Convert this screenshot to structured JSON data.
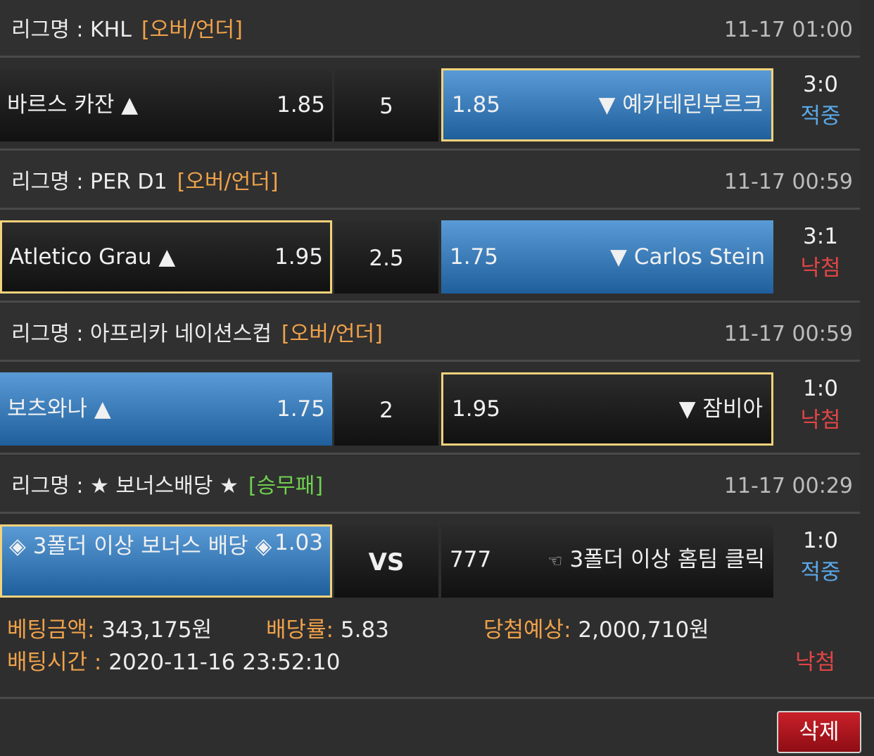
{
  "league_prefix": "리그명 : ",
  "matches": [
    {
      "league": "KHL",
      "bet_type": "[오버/언더]",
      "time": "11-17 01:00",
      "home": "바르스 카잔 ▲",
      "home_odds": "1.85",
      "line": "5",
      "away_odds": "1.85",
      "away": "▼ 예카테린부르크",
      "score": "3:0",
      "status": "적중"
    },
    {
      "league": "PER D1",
      "bet_type": "[오버/언더]",
      "time": "11-17 00:59",
      "home": "Atletico Grau ▲",
      "home_odds": "1.95",
      "line": "2.5",
      "away_odds": "1.75",
      "away": "▼ Carlos Stein",
      "score": "3:1",
      "status": "낙첨"
    },
    {
      "league": "아프리카 네이션스컵",
      "bet_type": "[오버/언더]",
      "time": "11-17 00:59",
      "home": "보츠와나 ▲",
      "home_odds": "1.75",
      "line": "2",
      "away_odds": "1.95",
      "away": "▼ 잠비아",
      "score": "1:0",
      "status": "낙첨"
    },
    {
      "league": "★ 보너스배당 ★",
      "bet_type": "[승무패]",
      "time": "11-17 00:29",
      "home": "◈ 3폴더 이상 보너스 배당 ◈",
      "home_odds": "1.03",
      "line": "VS",
      "away_odds": "777",
      "away_icon": "☜",
      "away": "3폴더 이상 홈팀 클릭",
      "score": "1:0",
      "status": "적중"
    }
  ],
  "summary": {
    "amount_label": "베팅금액:",
    "amount": "343,175원",
    "rate_label": "배당률:",
    "rate": "5.83",
    "expected_label": "당첨예상:",
    "expected": "2,000,710원",
    "time_label": "배팅시간 :",
    "time": "2020-11-16 23:52:10",
    "result": "낙첨"
  },
  "delete_label": "삭제",
  "colors": {
    "accent_orange": "#f0a24a",
    "accent_green": "#6fd14f",
    "selected_border": "#f2d27a",
    "hit_blue": "#5aa8e8",
    "miss_red": "#e04545",
    "delete_red": "#c9202a"
  }
}
